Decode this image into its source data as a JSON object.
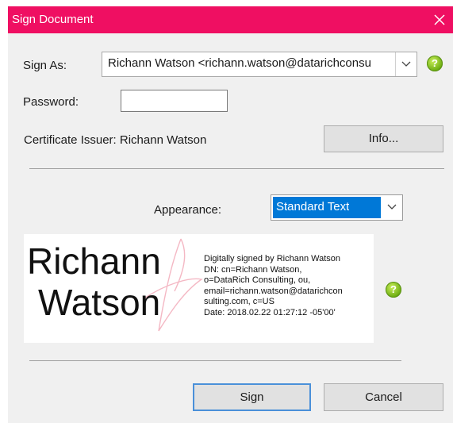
{
  "window": {
    "title": "Sign Document",
    "titlebar_color": "#ef0f62"
  },
  "sign_as": {
    "label": "Sign As:",
    "value": "Richann Watson <richann.watson@datarichconsu"
  },
  "password": {
    "label": "Password:",
    "value": ""
  },
  "certificate": {
    "issuer_text": "Certificate Issuer: Richann Watson",
    "info_button": "Info..."
  },
  "appearance": {
    "label": "Appearance:",
    "selected": "Standard Text"
  },
  "preview": {
    "name_line1": "Richann",
    "name_line2": "Watson",
    "details": [
      "Digitally signed by Richann Watson",
      "DN: cn=Richann Watson,",
      "o=DataRich Consulting, ou,",
      "email=richann.watson@datarichcon",
      "sulting.com, c=US",
      "Date: 2018.02.22 01:27:12 -05'00'"
    ]
  },
  "buttons": {
    "sign": "Sign",
    "cancel": "Cancel"
  },
  "icons": {
    "help": "help-icon",
    "close": "close-icon",
    "dropdown": "chevron-down-icon",
    "watermark": "acrobat-logo"
  }
}
